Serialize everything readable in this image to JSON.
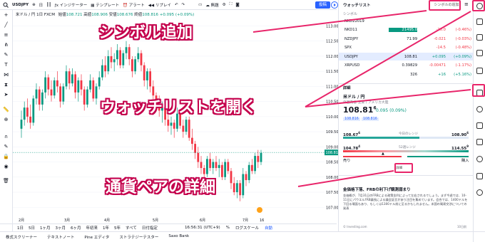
{
  "topbar": {
    "symbol": "USDJPY",
    "interval": "日",
    "indicators_label": "インジケーター",
    "templates_label": "テンプレート",
    "alert_label": "アラート",
    "replay_label": "リプレイ",
    "unnamed_label": "無題",
    "post_label": "投稿"
  },
  "legend": {
    "title": "米ドル / 円",
    "interval": "1日",
    "exchange": "FXCM",
    "open_label": "始値",
    "open": "108.721",
    "high_label": "高値",
    "high": "108.906",
    "low_label": "安値",
    "low": "108.676",
    "close_label": "終値",
    "close": "108.816",
    "change": "+0.095 (+0.09%)"
  },
  "chart_data": {
    "type": "candlestick",
    "ylim": [
      106.7,
      113.2
    ],
    "y_ticks": [
      "113.000",
      "112.500",
      "112.000",
      "111.500",
      "111.000",
      "110.500",
      "110.000",
      "109.500",
      "109.000",
      "108.500",
      "108.000",
      "107.500",
      "107.000"
    ],
    "x_ticks": [
      "2月",
      "3月",
      "4月",
      "5月",
      "6月",
      "7月",
      "16"
    ],
    "last_price_tag": "108.816",
    "candles": [
      [
        109.6,
        110.2,
        109.3,
        109.9
      ],
      [
        109.9,
        110.5,
        109.7,
        110.3
      ],
      [
        110.3,
        110.6,
        109.8,
        110.0
      ],
      [
        110.0,
        110.4,
        109.6,
        109.8
      ],
      [
        109.8,
        110.7,
        109.7,
        110.6
      ],
      [
        110.6,
        111.1,
        110.4,
        110.9
      ],
      [
        110.9,
        111.0,
        110.2,
        110.4
      ],
      [
        110.4,
        110.9,
        110.2,
        110.8
      ],
      [
        110.8,
        111.5,
        110.6,
        111.3
      ],
      [
        111.3,
        111.4,
        110.7,
        110.9
      ],
      [
        110.9,
        111.2,
        110.5,
        110.7
      ],
      [
        110.7,
        111.3,
        110.6,
        111.2
      ],
      [
        111.2,
        111.5,
        110.8,
        111.0
      ],
      [
        111.0,
        111.1,
        110.3,
        110.5
      ],
      [
        110.5,
        111.1,
        110.4,
        111.0
      ],
      [
        111.0,
        111.7,
        110.9,
        111.5
      ],
      [
        111.5,
        111.6,
        110.9,
        111.1
      ],
      [
        111.1,
        111.6,
        111.0,
        111.4
      ],
      [
        111.4,
        111.5,
        110.6,
        110.8
      ],
      [
        110.8,
        111.3,
        110.5,
        111.2
      ],
      [
        111.2,
        111.4,
        110.7,
        110.9
      ],
      [
        110.9,
        111.0,
        110.2,
        110.4
      ],
      [
        110.4,
        111.0,
        110.3,
        110.9
      ],
      [
        110.9,
        111.4,
        110.8,
        111.2
      ],
      [
        111.2,
        111.3,
        110.5,
        110.6
      ],
      [
        110.6,
        111.1,
        110.4,
        111.0
      ],
      [
        111.0,
        111.5,
        110.9,
        111.3
      ],
      [
        111.3,
        111.9,
        111.2,
        111.7
      ],
      [
        111.7,
        112.0,
        111.3,
        111.5
      ],
      [
        111.5,
        112.2,
        111.4,
        112.0
      ],
      [
        112.0,
        112.3,
        111.6,
        111.8
      ],
      [
        111.8,
        112.1,
        111.5,
        111.9
      ],
      [
        111.9,
        112.4,
        111.7,
        112.2
      ],
      [
        112.2,
        112.3,
        111.6,
        111.7
      ],
      [
        111.7,
        112.2,
        111.6,
        112.1
      ],
      [
        112.1,
        112.5,
        111.9,
        112.3
      ],
      [
        112.3,
        112.4,
        111.7,
        111.9
      ],
      [
        111.9,
        112.0,
        111.3,
        111.5
      ],
      [
        111.5,
        112.0,
        111.4,
        111.9
      ],
      [
        111.9,
        112.3,
        111.8,
        112.1
      ],
      [
        112.1,
        112.2,
        111.5,
        111.7
      ],
      [
        111.7,
        111.8,
        111.0,
        111.2
      ],
      [
        111.2,
        111.6,
        110.9,
        111.5
      ],
      [
        111.5,
        111.6,
        110.8,
        111.0
      ],
      [
        111.0,
        111.2,
        110.5,
        110.7
      ],
      [
        110.7,
        110.8,
        110.2,
        110.4
      ],
      [
        110.4,
        110.7,
        110.0,
        110.2
      ],
      [
        110.2,
        110.5,
        109.8,
        110.3
      ],
      [
        110.3,
        110.4,
        109.7,
        109.9
      ],
      [
        109.9,
        110.1,
        109.5,
        109.7
      ],
      [
        109.7,
        110.0,
        109.4,
        109.8
      ],
      [
        109.8,
        109.9,
        109.3,
        109.6
      ],
      [
        109.6,
        110.3,
        109.5,
        110.1
      ],
      [
        110.1,
        110.2,
        109.6,
        109.7
      ],
      [
        109.7,
        109.9,
        109.3,
        109.5
      ],
      [
        109.5,
        110.0,
        109.4,
        109.9
      ],
      [
        109.9,
        110.0,
        109.2,
        109.3
      ],
      [
        109.3,
        109.6,
        108.9,
        109.1
      ],
      [
        109.1,
        109.2,
        108.6,
        108.8
      ],
      [
        108.8,
        109.0,
        108.3,
        108.5
      ],
      [
        108.5,
        108.7,
        108.1,
        108.3
      ],
      [
        108.3,
        108.4,
        107.9,
        108.1
      ],
      [
        108.1,
        108.7,
        108.0,
        108.6
      ],
      [
        108.6,
        108.8,
        108.2,
        108.3
      ],
      [
        108.3,
        108.6,
        108.1,
        108.5
      ],
      [
        108.5,
        108.7,
        108.2,
        108.3
      ],
      [
        108.3,
        108.6,
        108.0,
        108.4
      ],
      [
        108.4,
        108.5,
        107.9,
        108.0
      ],
      [
        108.0,
        108.6,
        107.9,
        108.5
      ],
      [
        108.5,
        108.6,
        108.1,
        108.2
      ],
      [
        108.2,
        108.3,
        107.6,
        107.8
      ],
      [
        107.8,
        108.0,
        107.4,
        107.5
      ],
      [
        107.5,
        107.9,
        107.3,
        107.8
      ],
      [
        107.8,
        107.9,
        107.2,
        107.4
      ],
      [
        107.4,
        108.3,
        107.3,
        108.1
      ],
      [
        108.1,
        108.2,
        107.7,
        107.9
      ],
      [
        107.9,
        108.5,
        107.8,
        108.4
      ],
      [
        108.4,
        108.6,
        108.1,
        108.2
      ],
      [
        108.2,
        108.8,
        108.1,
        108.7
      ],
      [
        108.7,
        108.9,
        108.3,
        108.5
      ],
      [
        108.5,
        108.9,
        108.4,
        108.8
      ]
    ]
  },
  "bottombar": {
    "ranges": [
      "1日",
      "5日",
      "1ヶ月",
      "3ヶ月",
      "6ヶ月",
      "年初来",
      "1年",
      "5年",
      "すべて",
      "日付指定"
    ],
    "time": "16:56:31 (UTC+9)",
    "percent": "%",
    "log": "ログスケール",
    "auto": "自動"
  },
  "footer": {
    "tabs": [
      "株式スクリーナー",
      "テキストノート",
      "Pine エディタ",
      "ストラテジーテスター",
      "Saxo Bank"
    ]
  },
  "watchlist": {
    "header": "ウォッチリスト",
    "add_symbol": "シンボルの追加",
    "col_symbol": "シンボル",
    "rows": [
      {
        "sym": "NKD22019",
        "last": "",
        "chg": "",
        "chgp": "",
        "color": "#131722"
      },
      {
        "sym": "NKD11",
        "last": "21495.0",
        "chg": "-20.0",
        "chgp": "-0.46%",
        "color": "#f23645"
      },
      {
        "sym": "NZDJPY",
        "last": "71.99",
        "chg": "-0.021",
        "chgp": "-0.03%",
        "color": "#f23645"
      },
      {
        "sym": "SPX",
        "last": "",
        "chg": "-14.5",
        "chgp": "-0.48%",
        "color": "#f23645"
      },
      {
        "sym": "USDJPY",
        "last": "108.81",
        "chg": "+0.095",
        "chgp": "+0.09%",
        "color": "#089981"
      },
      {
        "sym": "XRPUSD",
        "last": "0.39829",
        "chg": "-0.00471",
        "chgp": "-1.17%",
        "color": "#f23645"
      },
      {
        "sym": "",
        "last": "326",
        "chg": "+16",
        "chgp": "+5.16%",
        "color": "#089981"
      }
    ]
  },
  "details": {
    "section": "詳細",
    "name": "米ドル / 円",
    "type": "外国為替 主要 / アメリカ大陸",
    "price": "108.81",
    "price_sup": "6",
    "change": "0.095 (0.09%)",
    "bid": "108.816",
    "ask": "108.816",
    "day_low": "108.67",
    "day_low_sup": "6",
    "day_range_label": "今日のレンジ",
    "day_high": "108.90",
    "day_high_sup": "6",
    "year_low": "104.78",
    "year_low_sup": "4",
    "year_range_label": "52週レンジ",
    "year_high": "114.55",
    "year_high_sup": "9",
    "sell": "売り",
    "buy": "購入",
    "more": "詳細"
  },
  "news": {
    "headline": "金価格下落、FRBの利下げ観測弱まり",
    "body": "金価格が、7月31日のFRBによる政策金利によって左右されるでしょう。まず今週では、10-11日にパウエルFRB議長による議会証言があり注目を集めています。会合では、1400ドルを下回る場面もあり、もしくは1300ドル前に至るかもしれません。米国の貿易交渉についての発表",
    "source": "© Investing.com",
    "date": "10日前"
  },
  "annotations": {
    "symbol_add": "シンボル追加",
    "open_watchlist": "ウォッチリストを開く",
    "pair_detail": "通貨ペアの詳細"
  },
  "colors": {
    "up": "#089981",
    "down": "#f23645",
    "accent": "#2962ff",
    "callout": "#e8256a"
  }
}
